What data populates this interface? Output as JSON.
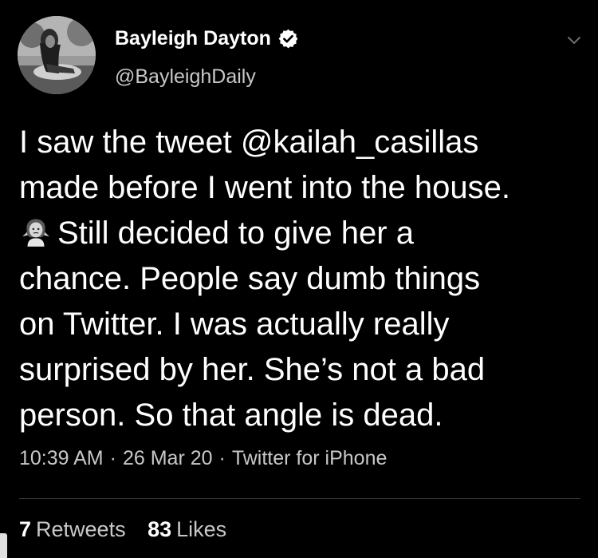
{
  "author": {
    "display_name": "Bayleigh Dayton",
    "handle": "@BayleighDaily",
    "verified": true,
    "avatar_icon": "profile-photo"
  },
  "tweet": {
    "lines": [
      "I saw the tweet @kailah_casillas",
      "made before I went into the house.",
      "Still decided to give her a",
      "chance. People say dumb things",
      "on Twitter. I was actually really",
      "surprised by her. She’s not a bad",
      "person. So that angle is dead."
    ],
    "emoji_icon": "woman-shrugging-emoji"
  },
  "meta": {
    "time": "10:39 AM",
    "separator": "·",
    "date": "26 Mar 20",
    "source": "Twitter for iPhone"
  },
  "stats": {
    "retweets_count": "7",
    "retweets_label": "Retweets",
    "likes_count": "83",
    "likes_label": "Likes"
  },
  "colors": {
    "background": "#000000",
    "primary_text": "#ffffff",
    "secondary_text": "#c8c8c8",
    "divider": "#333333"
  }
}
